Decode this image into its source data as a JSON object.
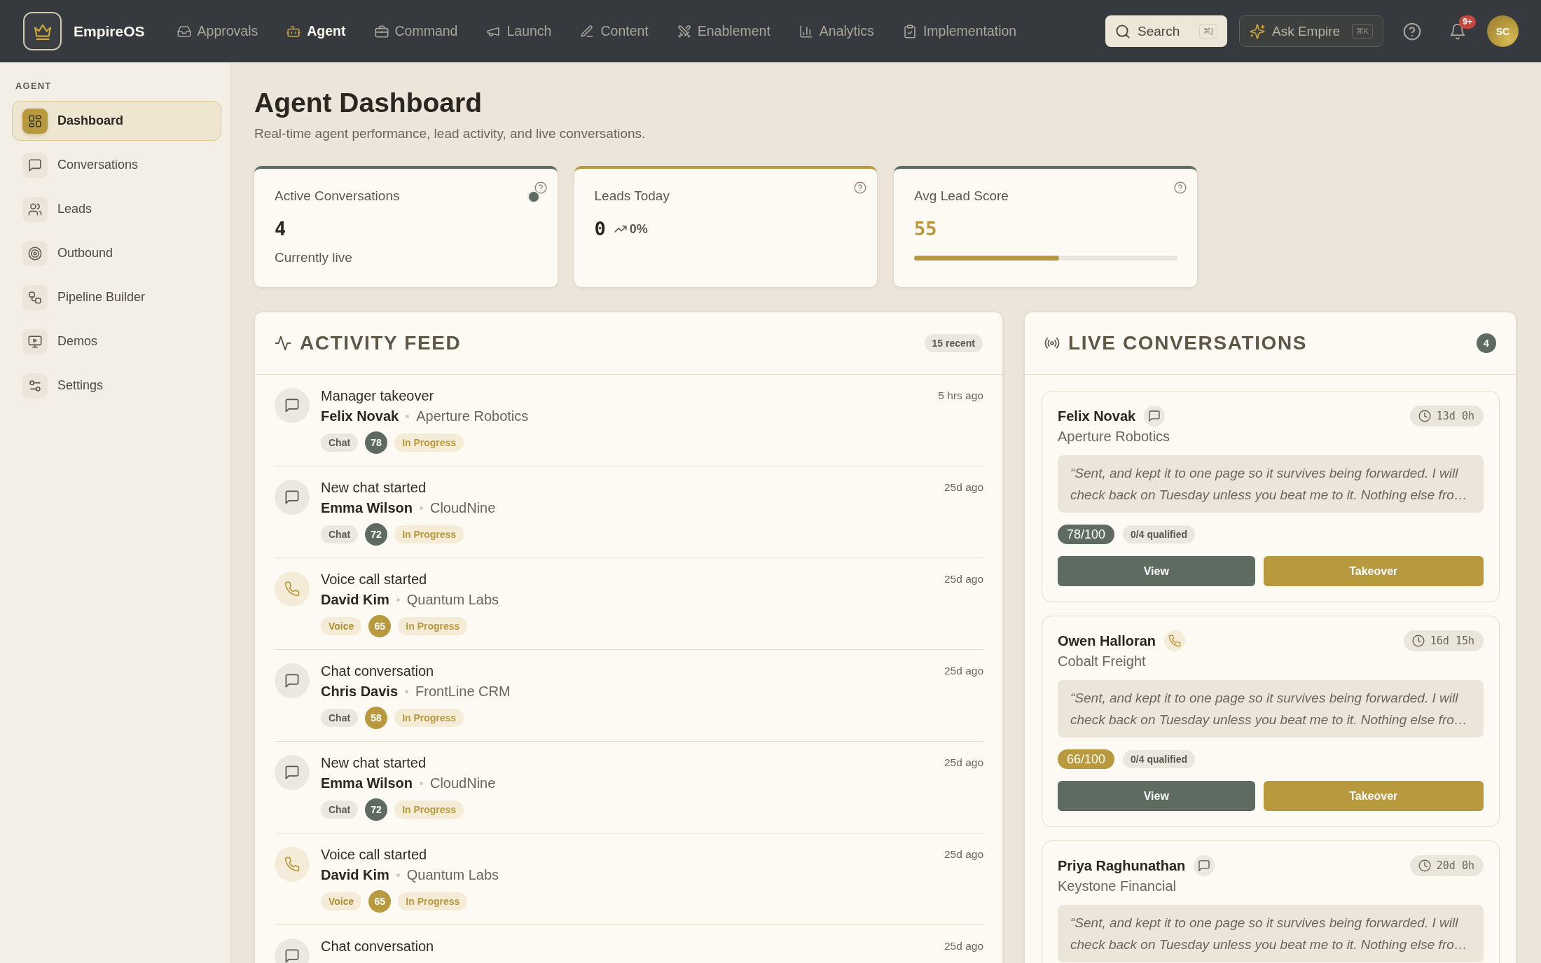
{
  "topbar": {
    "brand": "EmpireOS",
    "nav": [
      {
        "label": "Approvals",
        "selected": false
      },
      {
        "label": "Agent",
        "selected": true
      },
      {
        "label": "Command",
        "selected": false
      },
      {
        "label": "Launch",
        "selected": false
      },
      {
        "label": "Content",
        "selected": false
      },
      {
        "label": "Enablement",
        "selected": false
      },
      {
        "label": "Analytics",
        "selected": false
      },
      {
        "label": "Implementation",
        "selected": false
      }
    ],
    "search": {
      "label": "Search",
      "shortcut": "⌘J"
    },
    "assistant": {
      "label": "Ask Empire",
      "shortcut": "⌘K"
    },
    "notifications": {
      "count": "9+"
    },
    "avatar": {
      "initials": "SC"
    }
  },
  "sidebar": {
    "section": "AGENT",
    "items": [
      {
        "label": "Dashboard",
        "selected": true
      },
      {
        "label": "Conversations",
        "selected": false
      },
      {
        "label": "Leads",
        "selected": false
      },
      {
        "label": "Outbound",
        "selected": false
      },
      {
        "label": "Pipeline Builder",
        "selected": false
      },
      {
        "label": "Demos",
        "selected": false
      },
      {
        "label": "Settings",
        "selected": false
      }
    ]
  },
  "header": {
    "title": "Agent Dashboard",
    "subtitle": "Real-time agent performance, lead activity, and live conversations."
  },
  "stats": [
    {
      "kind": "live",
      "label": "Active Conversations",
      "value": "4",
      "note": "Currently live",
      "color": "#5d6b60"
    },
    {
      "kind": "trend",
      "label": "Leads Today",
      "value": "0",
      "change": "0%",
      "color": "#b8993e"
    },
    {
      "kind": "score",
      "label": "Avg Lead Score",
      "value": "55",
      "level": 0.55,
      "color": "#5d6b60"
    }
  ],
  "activity_feed": {
    "title": "ACTIVITY FEED",
    "count": "15 recent",
    "items": [
      {
        "kind": "chat",
        "title": "Manager takeover",
        "name": "Felix Novak",
        "company": "Aperture Robotics",
        "channel": "Chat",
        "score": {
          "text": "78",
          "color": "#5d6b60"
        },
        "status": "In Progress",
        "time": "5 hrs ago"
      },
      {
        "kind": "chat",
        "title": "New chat started",
        "name": "Emma Wilson",
        "company": "CloudNine",
        "channel": "Chat",
        "score": {
          "text": "72",
          "color": "#5d6b60"
        },
        "status": "In Progress",
        "time": "25d ago"
      },
      {
        "kind": "voice",
        "title": "Voice call started",
        "name": "David Kim",
        "company": "Quantum Labs",
        "channel": "Voice",
        "score": {
          "text": "65",
          "color": "#b8993e"
        },
        "status": "In Progress",
        "time": "25d ago"
      },
      {
        "kind": "chat",
        "title": "Chat conversation",
        "name": "Chris Davis",
        "company": "FrontLine CRM",
        "channel": "Chat",
        "score": {
          "text": "58",
          "color": "#b8993e"
        },
        "status": "In Progress",
        "time": "25d ago"
      },
      {
        "kind": "chat",
        "title": "New chat started",
        "name": "Emma Wilson",
        "company": "CloudNine",
        "channel": "Chat",
        "score": {
          "text": "72",
          "color": "#5d6b60"
        },
        "status": "In Progress",
        "time": "25d ago"
      },
      {
        "kind": "voice",
        "title": "Voice call started",
        "name": "David Kim",
        "company": "Quantum Labs",
        "channel": "Voice",
        "score": {
          "text": "65",
          "color": "#b8993e"
        },
        "status": "In Progress",
        "time": "25d ago"
      },
      {
        "kind": "chat",
        "title": "Chat conversation",
        "time": "25d ago"
      }
    ]
  },
  "live_conversations": {
    "title": "LIVE CONVERSATIONS",
    "count": "4",
    "cards": [
      {
        "kind": "chat",
        "name": "Felix Novak",
        "duration": "13d 0h",
        "company": "Aperture Robotics",
        "quote": "“Sent, and kept it to one page so it survives being forwarded. I will check back on Tuesday unless you beat me to it. Nothing else fro…",
        "score": {
          "text": "78/100",
          "color": "#5d6b60"
        },
        "qualified": "0/4 qualified",
        "actions": [
          {
            "kind": "secondary",
            "label": "View"
          },
          {
            "kind": "primary",
            "label": "Takeover"
          }
        ]
      },
      {
        "kind": "voice",
        "name": "Owen Halloran",
        "duration": "16d 15h",
        "company": "Cobalt Freight",
        "quote": "“Sent, and kept it to one page so it survives being forwarded. I will check back on Tuesday unless you beat me to it. Nothing else fro…",
        "score": {
          "text": "66/100",
          "color": "#b8993e"
        },
        "qualified": "0/4 qualified",
        "actions": [
          {
            "kind": "secondary",
            "label": "View"
          },
          {
            "kind": "primary",
            "label": "Takeover"
          }
        ]
      },
      {
        "kind": "chat",
        "name": "Priya Raghunathan",
        "duration": "20d 0h",
        "company": "Keystone Financial",
        "quote": "“Sent, and kept it to one page so it survives being forwarded. I will check back on Tuesday unless you beat me to it. Nothing else fro…"
      }
    ]
  }
}
